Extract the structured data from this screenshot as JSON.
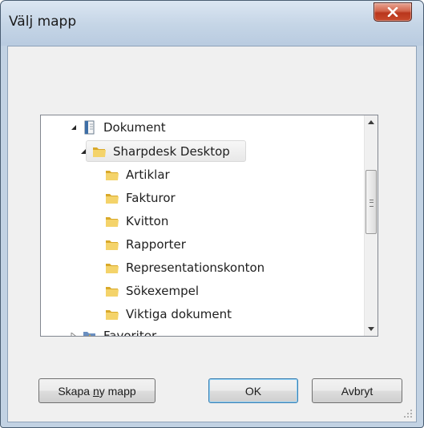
{
  "window": {
    "title": "Välj mapp"
  },
  "tree": {
    "items": [
      {
        "label": "Dokument",
        "level": 0,
        "expanded": true,
        "icon": "documents-library-icon"
      },
      {
        "label": "Sharpdesk Desktop",
        "level": 1,
        "expanded": true,
        "selected": true,
        "icon": "folder-icon"
      },
      {
        "label": "Artiklar",
        "level": 2,
        "icon": "folder-icon"
      },
      {
        "label": "Fakturor",
        "level": 2,
        "icon": "folder-icon"
      },
      {
        "label": "Kvitton",
        "level": 2,
        "icon": "folder-icon"
      },
      {
        "label": "Rapporter",
        "level": 2,
        "icon": "folder-icon"
      },
      {
        "label": "Representationskonton",
        "level": 2,
        "icon": "folder-icon"
      },
      {
        "label": "Sökexempel",
        "level": 2,
        "icon": "folder-icon"
      },
      {
        "label": "Viktiga dokument",
        "level": 2,
        "icon": "folder-icon"
      },
      {
        "label": "Favoriter",
        "level": 0,
        "expanded": false,
        "icon": "favorites-icon"
      }
    ]
  },
  "buttons": {
    "new_folder_prefix": "Skapa ",
    "new_folder_mnemonic": "n",
    "new_folder_suffix": "y mapp",
    "ok": "OK",
    "cancel": "Avbryt"
  },
  "colors": {
    "folder": "#e8c04a",
    "accent": "#3c7fb1",
    "close": "#c84a2c"
  }
}
